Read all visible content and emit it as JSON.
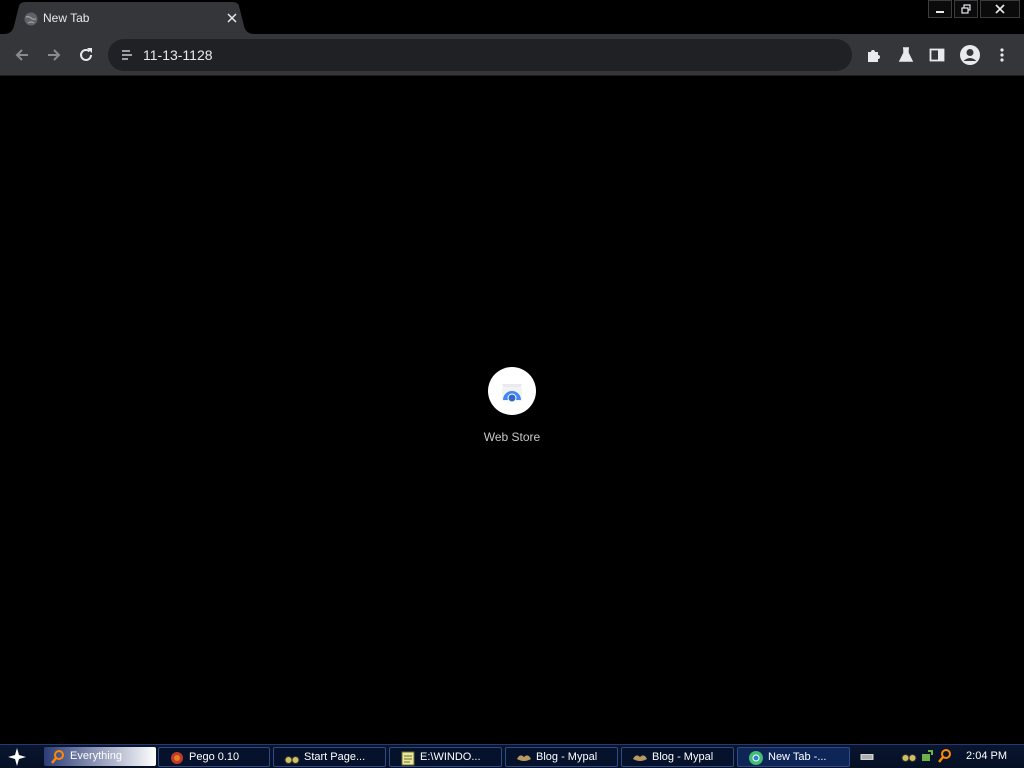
{
  "browser": {
    "tab": {
      "title": "New Tab",
      "favicon": "globe-icon",
      "close_icon": "close-icon"
    },
    "window_controls": [
      "minimize-icon",
      "restore-icon",
      "close-icon"
    ],
    "toolbar": {
      "back_icon": "back-arrow-icon",
      "forward_icon": "forward-arrow-icon",
      "reload_icon": "reload-icon",
      "address": "11-13-1128",
      "address_icon": "site-info-icon",
      "extensions_icon": "puzzle-icon",
      "labs_icon": "flask-icon",
      "side_panel_icon": "side-panel-icon",
      "profile_icon": "avatar-icon",
      "menu_icon": "kebab-menu-icon"
    },
    "shortcut": {
      "label": "Web Store",
      "icon": "web-store-icon"
    }
  },
  "taskbar": {
    "start_icon": "star-icon",
    "search": {
      "text": "Everything",
      "icon": "magnifier-icon"
    },
    "tasks": [
      {
        "label": "Pego 0.10",
        "icon": "pego-icon"
      },
      {
        "label": "Start Page...",
        "icon": "binoculars-icon"
      },
      {
        "label": "E:\\WINDO...",
        "icon": "notepad-icon"
      },
      {
        "label": "Blog - Mypal",
        "icon": "mypal-icon"
      },
      {
        "label": "Blog - Mypal",
        "icon": "mypal-icon"
      },
      {
        "label": "New Tab -...",
        "icon": "chrome-icon"
      }
    ],
    "tray": {
      "icons": [
        "keyboard-icon",
        "binoculars-icon",
        "network-icon",
        "magnifier-icon"
      ],
      "clock": "2:04 PM"
    }
  },
  "colors": {
    "toolbar": "#35363a",
    "omnibox": "#202124",
    "taskbar": "#0a1530",
    "text": "#e8eaed"
  }
}
